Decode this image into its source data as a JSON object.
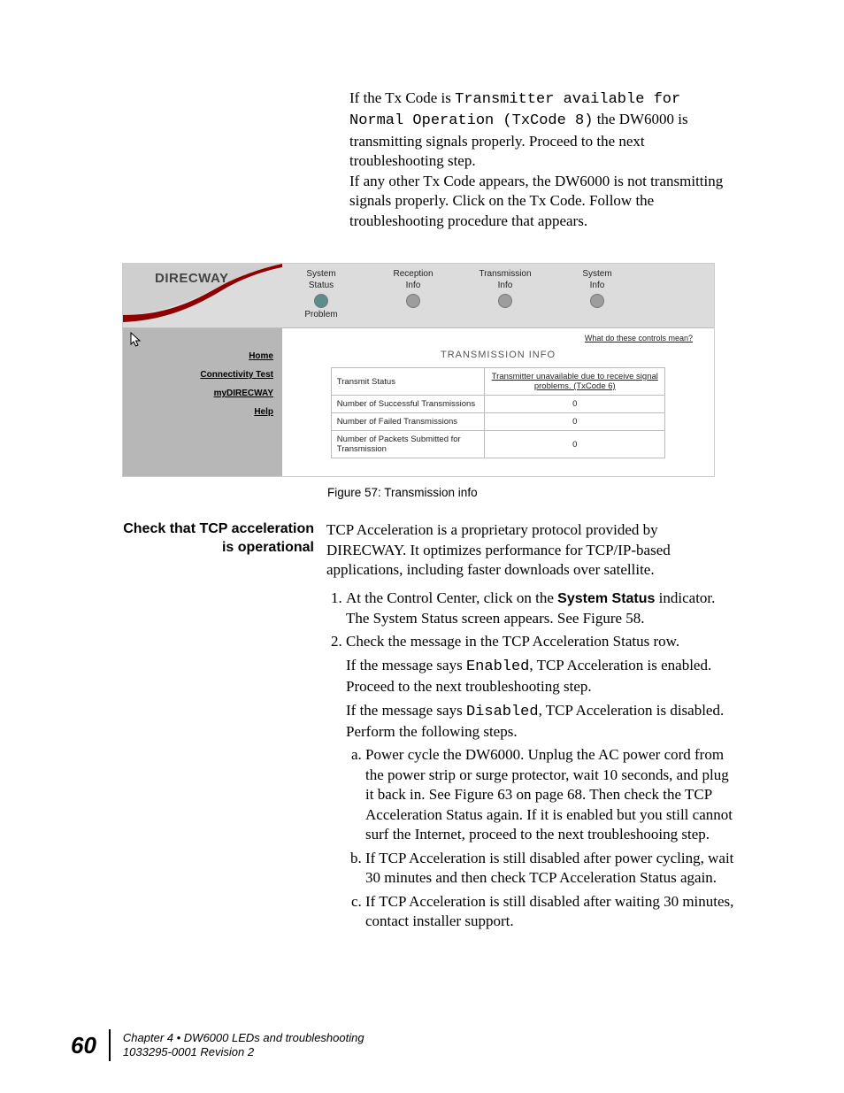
{
  "intro": {
    "p1a": "If the Tx Code is ",
    "p1mono": "Transmitter available for Normal Operation (TxCode 8)",
    "p1b": " the DW6000 is transmitting signals properly. Proceed to the next troubleshooting step.",
    "p2": "If any other Tx Code appears, the DW6000 is not transmitting signals properly. Click on the Tx Code. Follow the troubleshooting procedure that appears."
  },
  "shot": {
    "brand": "DIRECWAY",
    "statuses": [
      {
        "l1": "System",
        "l2": "Status",
        "l3": "Problem",
        "led": "bad"
      },
      {
        "l1": "Reception",
        "l2": "Info",
        "l3": "",
        "led": ""
      },
      {
        "l1": "Transmission",
        "l2": "Info",
        "l3": "",
        "led": ""
      },
      {
        "l1": "System",
        "l2": "Info",
        "l3": "",
        "led": ""
      }
    ],
    "sidebar": [
      "Home",
      "Connectivity Test",
      "myDIRECWAY",
      "Help"
    ],
    "hint": "What do these controls mean?",
    "section": "TRANSMISSION INFO",
    "rows": [
      {
        "k": "Transmit Status",
        "v": "Transmitter unavailable due to receive signal problems. (TxCode 6)",
        "link": true
      },
      {
        "k": "Number of Successful Transmissions",
        "v": "0"
      },
      {
        "k": "Number of Failed Transmissions",
        "v": "0"
      },
      {
        "k": "Number of Packets Submitted for Transmission",
        "v": "0"
      }
    ]
  },
  "fig_caption": "Figure 57:  Transmission info",
  "sec2": {
    "heading1": "Check that TCP acceleration",
    "heading2": "is operational",
    "para": "TCP Acceleration is a proprietary protocol provided by DIRECWAY. It optimizes performance for TCP/IP-based applications, including faster downloads over satellite.",
    "li1a": "At the Control Center, click on the ",
    "li1bold": "System Status",
    "li1b": " indicator. The System Status screen appears. See Figure 58.",
    "li2": "Check the message in the TCP Acceleration Status row.",
    "li2_en_a": "If the message says ",
    "li2_en_mono": "Enabled",
    "li2_en_b": ", TCP Acceleration is enabled. Proceed to the next troubleshooting step.",
    "li2_di_a": "If the message says ",
    "li2_di_mono": "Disabled",
    "li2_di_b": ", TCP Acceleration is disabled. Perform the following steps.",
    "sa": "Power cycle the DW6000. Unplug the AC power cord from the power strip or surge protector, wait 10 seconds, and plug it back in. See Figure 63 on page 68. Then check the TCP Acceleration Status again. If it is enabled but you still cannot surf the Internet, proceed to the next troubleshooing step.",
    "sb": "If TCP Acceleration is still disabled after power cycling, wait 30 minutes and then check TCP Acceleration Status again.",
    "sc": "If TCP Acceleration is still disabled after waiting 30 minutes, contact installer support."
  },
  "footer": {
    "page": "60",
    "chapter": "Chapter 4 • DW6000 LEDs and troubleshooting",
    "rev": "1033295-0001  Revision 2"
  }
}
